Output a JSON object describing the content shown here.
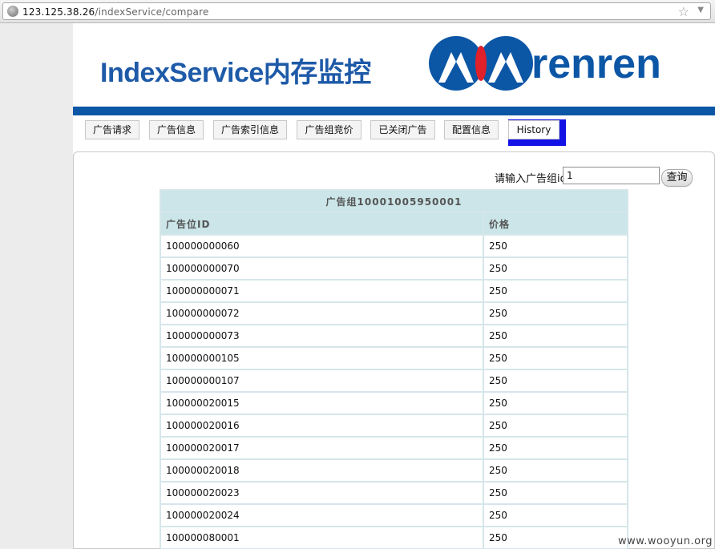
{
  "browser": {
    "url_host": "123.125.38.26",
    "url_path": "/indexService/compare"
  },
  "header": {
    "title": "IndexService内存监控",
    "logo_text": "renren"
  },
  "nav": {
    "items": [
      {
        "label": "广告请求"
      },
      {
        "label": "广告信息"
      },
      {
        "label": "广告索引信息"
      },
      {
        "label": "广告组竞价"
      },
      {
        "label": "已关闭广告"
      },
      {
        "label": "配置信息"
      },
      {
        "label": "History"
      }
    ],
    "active_index": 6
  },
  "search": {
    "label": "请输入广告组id",
    "value": "1",
    "button_label": "查询"
  },
  "table": {
    "caption": "广告组10001005950001",
    "headers": [
      "广告位ID",
      "价格"
    ],
    "rows": [
      [
        "100000000060",
        "250"
      ],
      [
        "100000000070",
        "250"
      ],
      [
        "100000000071",
        "250"
      ],
      [
        "100000000072",
        "250"
      ],
      [
        "100000000073",
        "250"
      ],
      [
        "100000000105",
        "250"
      ],
      [
        "100000000107",
        "250"
      ],
      [
        "100000020015",
        "250"
      ],
      [
        "100000020016",
        "250"
      ],
      [
        "100000020017",
        "250"
      ],
      [
        "100000020018",
        "250"
      ],
      [
        "100000020023",
        "250"
      ],
      [
        "100000020024",
        "250"
      ],
      [
        "100000080001",
        "250"
      ]
    ]
  },
  "watermark": "www.wooyun.org",
  "colors": {
    "title_blue": "#1e5aa8",
    "stripe_blue": "#0c56a6",
    "active_tab_blue": "#1212e6",
    "logo_red": "#e0202a",
    "table_header_bg": "#cbe5e8"
  }
}
